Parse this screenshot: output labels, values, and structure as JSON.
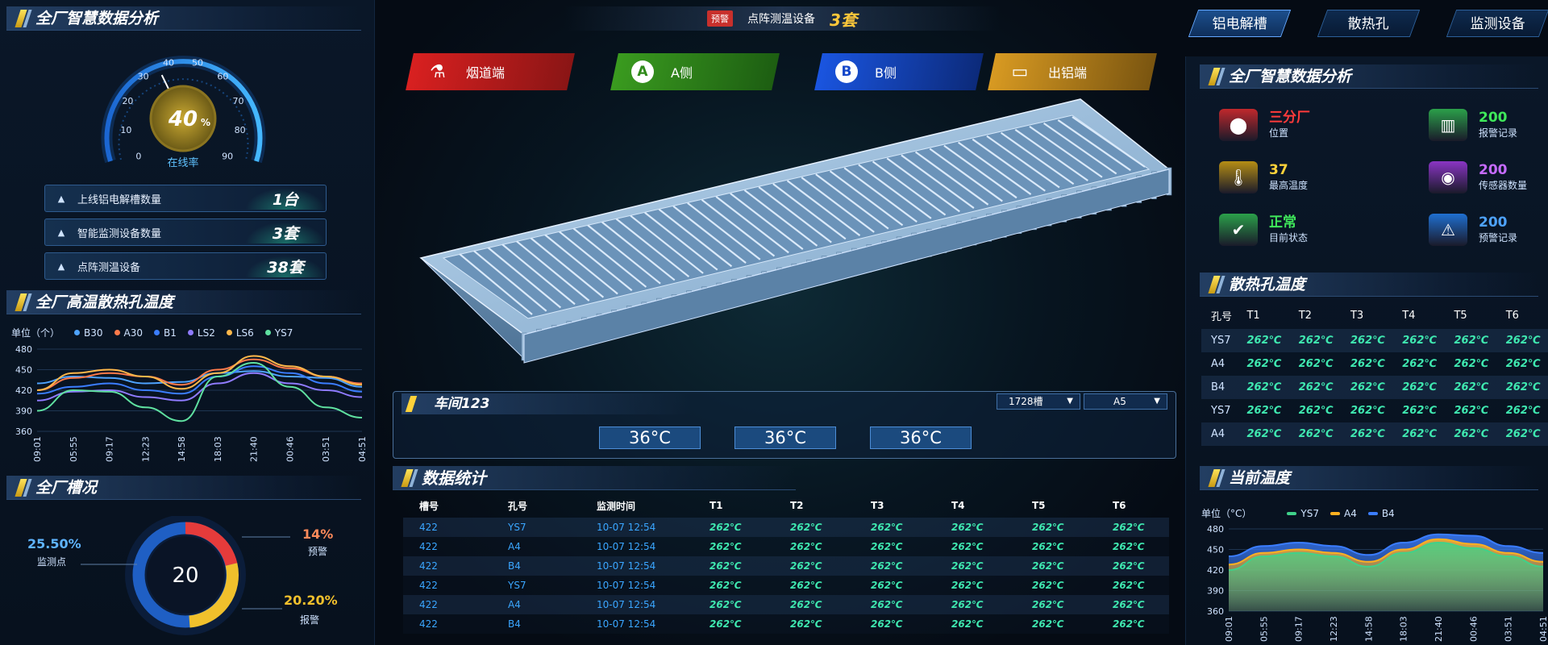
{
  "left": {
    "title1": "全厂智慧数据分析",
    "gauge": {
      "value_text": "40",
      "unit": "%",
      "value": 40,
      "label": "在线率",
      "ticks": [
        "0",
        "10",
        "20",
        "30",
        "40",
        "50",
        "60",
        "70",
        "80",
        "90"
      ]
    },
    "stats": [
      {
        "label": "上线铝电解槽数量",
        "value": "1台"
      },
      {
        "label": "智能监测设备数量",
        "value": "3套"
      },
      {
        "label": "点阵测温设备",
        "value": "38套"
      }
    ],
    "title2": "全厂高温散热孔温度",
    "title3": "全厂槽况",
    "donut": {
      "center": "20",
      "left_pct": "25.50%",
      "left_label": "监测点",
      "right_top_pct": "14%",
      "right_top_label": "预警",
      "right_bottom_pct": "20.20%",
      "right_bottom_label": "报警"
    }
  },
  "chart_data": [
    {
      "type": "line",
      "title": "",
      "ylabel": "单位（个）",
      "x": [
        "09:01",
        "05:55",
        "09:17",
        "12:23",
        "14:58",
        "18:03",
        "21:40",
        "00:46",
        "03:51",
        "04:51"
      ],
      "ylim": [
        360,
        480
      ],
      "yticks": [
        "480",
        "450",
        "420",
        "390",
        "360"
      ],
      "legend_position": "top",
      "series": [
        {
          "name": "B30",
          "color": "#4ea3ff",
          "values": [
            430,
            440,
            438,
            430,
            432,
            445,
            448,
            440,
            438,
            425
          ]
        },
        {
          "name": "A30",
          "color": "#ff7a4a",
          "values": [
            420,
            438,
            445,
            440,
            428,
            450,
            465,
            452,
            440,
            430
          ]
        },
        {
          "name": "B1",
          "color": "#3b7dff",
          "values": [
            415,
            425,
            430,
            420,
            415,
            440,
            455,
            445,
            430,
            418
          ]
        },
        {
          "name": "LS2",
          "color": "#8f7bff",
          "values": [
            405,
            418,
            420,
            410,
            405,
            430,
            445,
            430,
            420,
            410
          ]
        },
        {
          "name": "LS6",
          "color": "#ffb84a",
          "values": [
            420,
            445,
            450,
            440,
            422,
            445,
            470,
            455,
            440,
            428
          ]
        },
        {
          "name": "YS7",
          "color": "#5fe0a0",
          "values": [
            390,
            420,
            418,
            395,
            375,
            440,
            460,
            425,
            395,
            380
          ]
        }
      ]
    },
    {
      "type": "area",
      "title": "当前温度",
      "ylabel": "单位（°C）",
      "x": [
        "09:01",
        "05:55",
        "09:17",
        "12:23",
        "14:58",
        "18:03",
        "21:40",
        "00:46",
        "03:51",
        "04:51"
      ],
      "ylim": [
        360,
        480
      ],
      "yticks": [
        "480",
        "450",
        "420",
        "390",
        "360"
      ],
      "legend_position": "top",
      "series": [
        {
          "name": "YS7",
          "color": "#3fd18a",
          "values": [
            420,
            440,
            445,
            440,
            425,
            445,
            460,
            452,
            440,
            425
          ]
        },
        {
          "name": "A4",
          "color": "#ffb020",
          "values": [
            428,
            445,
            450,
            445,
            432,
            450,
            465,
            458,
            445,
            432
          ]
        },
        {
          "name": "B4",
          "color": "#3b7dff",
          "values": [
            440,
            455,
            460,
            455,
            442,
            460,
            472,
            470,
            455,
            445
          ]
        }
      ]
    }
  ],
  "center": {
    "alert_badge": "预警",
    "alert_text": "点阵测温设备",
    "alert_count": "3套",
    "buttons": [
      {
        "label": "烟道端",
        "icon": "flue-icon",
        "color": "#c8201c"
      },
      {
        "label": "A侧",
        "icon": "A",
        "color": "#2f8a1a"
      },
      {
        "label": "B侧",
        "icon": "B",
        "color": "#1547c9"
      },
      {
        "label": "出铝端",
        "icon": "aluminum-ingot-icon",
        "color": "#c9861a"
      }
    ],
    "workshop": {
      "title": "车间123",
      "select1": "1728槽",
      "select2": "A5",
      "temps": [
        "36°C",
        "36°C",
        "36°C"
      ]
    },
    "data_stats": {
      "title": "数据统计",
      "headers": [
        "槽号",
        "孔号",
        "监测时间",
        "T1",
        "T2",
        "T3",
        "T4",
        "T5",
        "T6"
      ],
      "rows": [
        [
          "422",
          "YS7",
          "10-07 12:54",
          "262℃",
          "262℃",
          "262℃",
          "262℃",
          "262℃",
          "262℃"
        ],
        [
          "422",
          "A4",
          "10-07 12:54",
          "262℃",
          "262℃",
          "262℃",
          "262℃",
          "262℃",
          "262℃"
        ],
        [
          "422",
          "B4",
          "10-07 12:54",
          "262℃",
          "262℃",
          "262℃",
          "262℃",
          "262℃",
          "262℃"
        ],
        [
          "422",
          "YS7",
          "10-07 12:54",
          "262℃",
          "262℃",
          "262℃",
          "262℃",
          "262℃",
          "262℃"
        ],
        [
          "422",
          "A4",
          "10-07 12:54",
          "262℃",
          "262℃",
          "262℃",
          "262℃",
          "262℃",
          "262℃"
        ],
        [
          "422",
          "B4",
          "10-07 12:54",
          "262℃",
          "262℃",
          "262℃",
          "262℃",
          "262℃",
          "262℃"
        ]
      ]
    }
  },
  "top_tabs": [
    "铝电解槽",
    "散热孔",
    "监测设备"
  ],
  "right": {
    "title1": "全厂智慧数据分析",
    "info": [
      {
        "value": "三分厂",
        "label": "位置",
        "color": "#ff3b3b",
        "icon": "location-icon",
        "box": "#c0282c"
      },
      {
        "value": "200",
        "label": "报警记录",
        "color": "#3fe85a",
        "icon": "factory-icon",
        "box": "#2ba04a"
      },
      {
        "value": "37",
        "label": "最高温度",
        "color": "#ffd23a",
        "icon": "thermometer-icon",
        "box": "#b58d14"
      },
      {
        "value": "200",
        "label": "传感器数量",
        "color": "#c66bff",
        "icon": "sensor-icon",
        "box": "#8a35c4"
      },
      {
        "value": "正常",
        "label": "目前状态",
        "color": "#3fe85a",
        "icon": "status-icon",
        "box": "#2ba04a"
      },
      {
        "value": "200",
        "label": "预警记录",
        "color": "#4ea3ff",
        "icon": "alarm-icon",
        "box": "#1f6fd0"
      }
    ],
    "title2": "散热孔温度",
    "hole_table": {
      "headers": [
        "孔号",
        "T1",
        "T2",
        "T3",
        "T4",
        "T5",
        "T6"
      ],
      "rows": [
        [
          "YS7",
          "262℃",
          "262℃",
          "262℃",
          "262℃",
          "262℃",
          "262℃"
        ],
        [
          "A4",
          "262℃",
          "262℃",
          "262℃",
          "262℃",
          "262℃",
          "262℃"
        ],
        [
          "B4",
          "262℃",
          "262℃",
          "262℃",
          "262℃",
          "262℃",
          "262℃"
        ],
        [
          "YS7",
          "262℃",
          "262℃",
          "262℃",
          "262℃",
          "262℃",
          "262℃"
        ],
        [
          "A4",
          "262℃",
          "262℃",
          "262℃",
          "262℃",
          "262℃",
          "262℃"
        ]
      ]
    },
    "title3": "当前温度"
  }
}
